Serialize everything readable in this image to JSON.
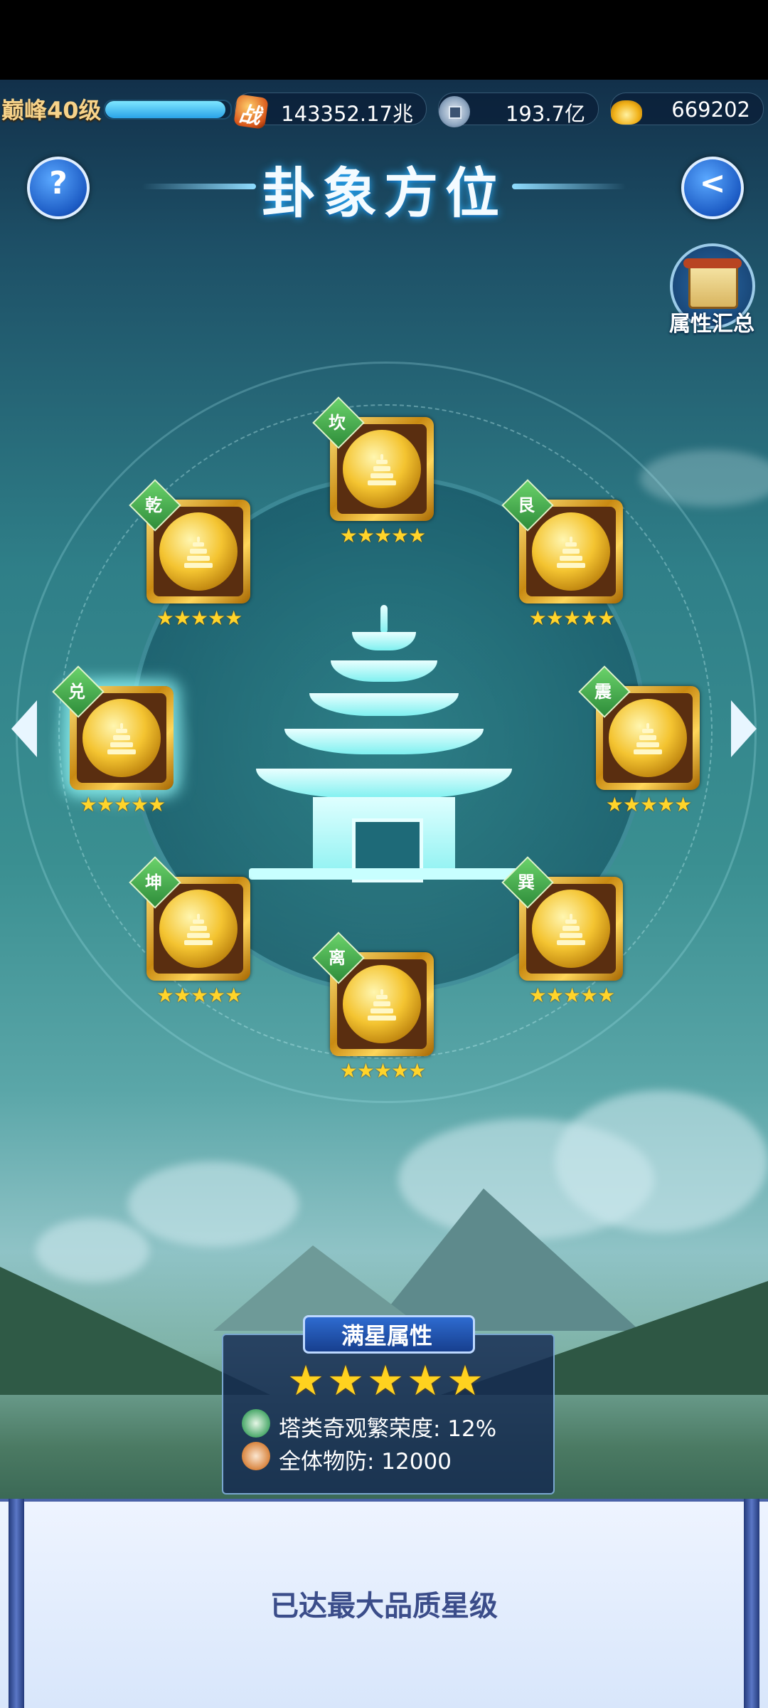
{
  "resources": {
    "level_label": "巅峰40级",
    "xp_fill": 0.96,
    "power": "143352.17兆",
    "silver": "193.7亿",
    "gold": "669202",
    "power_icon_char": "战"
  },
  "header": {
    "title": "卦象方位",
    "help_icon": "?",
    "back_icon": "<"
  },
  "summary": {
    "label": "属性汇总"
  },
  "trigrams": [
    {
      "id": "kan",
      "name": "坎",
      "stars": "★★★★★"
    },
    {
      "id": "gen",
      "name": "艮",
      "stars": "★★★★★"
    },
    {
      "id": "zhen",
      "name": "震",
      "stars": "★★★★★"
    },
    {
      "id": "xun",
      "name": "巽",
      "stars": "★★★★★"
    },
    {
      "id": "li",
      "name": "离",
      "stars": "★★★★★"
    },
    {
      "id": "kun",
      "name": "坤",
      "stars": "★★★★★"
    },
    {
      "id": "dui",
      "name": "兑",
      "stars": "★★★★★",
      "selected": true
    },
    {
      "id": "qian",
      "name": "乾",
      "stars": "★★★★★"
    }
  ],
  "full_star_panel": {
    "title": "满星属性",
    "stars": "★★★★★",
    "attributes": [
      {
        "text": "塔类奇观繁荣度: 12%",
        "icon": "leaf-icon"
      },
      {
        "text": "全体物防: 12000",
        "icon": "shield-icon"
      }
    ]
  },
  "status": {
    "message": "已达最大品质星级"
  },
  "colors": {
    "accent": "#2aa3e8",
    "gold": "#ffd42a",
    "badge": "#2e8c3a"
  }
}
